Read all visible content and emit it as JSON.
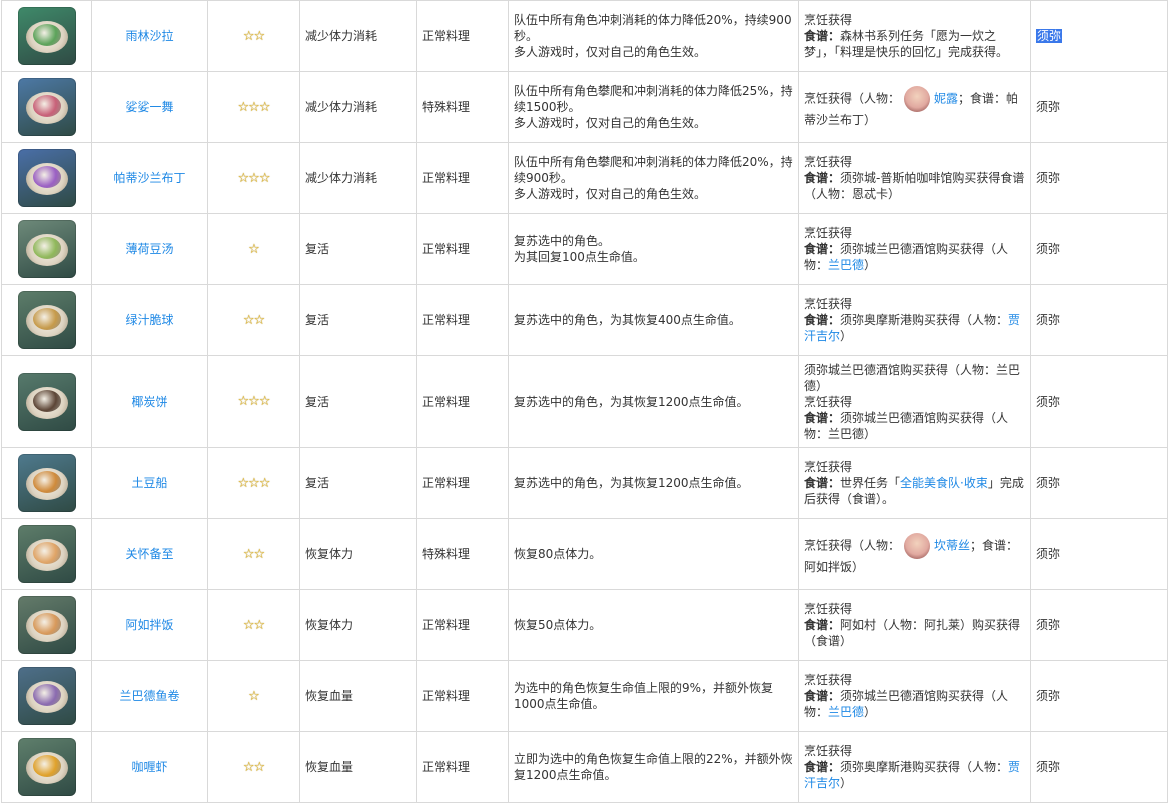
{
  "colors": {
    "link": "#1e88e5",
    "star": "#e8b923",
    "highlight": "#3a78ea",
    "border": "#d9d9d9"
  },
  "rows": [
    {
      "name": "雨林沙拉",
      "stars": "☆☆",
      "effect": "减少体力消耗",
      "type": "正常料理",
      "desc": [
        "队伍中所有角色冲刺消耗的体力降低20%，持续900秒。",
        "多人游戏时，仅对自己的角色生效。"
      ],
      "src": [
        {
          "t": "烹饪获得"
        },
        {
          "b": "食谱：",
          "t": "森林书系列任务「愿为一炊之梦」，「料理是快乐的回忆」完成获得。"
        }
      ],
      "region": "须弥",
      "region_selected": true,
      "icon": "salad-icon",
      "bg": "#3f8a6a",
      "food": "#5ba35a"
    },
    {
      "name": "娑娑一舞",
      "stars": "☆☆☆",
      "effect": "减少体力消耗",
      "type": "特殊料理",
      "desc": [
        "队伍中所有角色攀爬和冲刺消耗的体力降低25%，持续1500秒。",
        "多人游戏时，仅对自己的角色生效。"
      ],
      "src_avatar": {
        "pre": "烹饪获得（人物：",
        "char": "妮露",
        "post": "；食谱：帕蒂沙兰布丁）"
      },
      "region": "须弥",
      "icon": "pudding-icon",
      "bg": "#4d79a6",
      "food": "#c86078"
    },
    {
      "name": "帕蒂沙兰布丁",
      "stars": "☆☆☆",
      "effect": "减少体力消耗",
      "type": "正常料理",
      "desc": [
        "队伍中所有角色攀爬和冲刺消耗的体力降低20%，持续900秒。",
        "多人游戏时，仅对自己的角色生效。"
      ],
      "src": [
        {
          "t": "烹饪获得"
        },
        {
          "b": "食谱：",
          "t": "须弥城-普斯帕咖啡馆购买获得食谱（人物：恩忒卡）"
        }
      ],
      "region": "须弥",
      "icon": "purple-pudding-icon",
      "bg": "#4a6fa8",
      "food": "#9a5fc4"
    },
    {
      "name": "薄荷豆汤",
      "stars": "☆",
      "effect": "复活",
      "type": "正常料理",
      "desc": [
        "复苏选中的角色。",
        "为其回复100点生命值。"
      ],
      "src": [
        {
          "t": "烹饪获得"
        },
        {
          "b": "食谱：",
          "t": "须弥城兰巴德酒馆购买获得（人物：",
          "link": "兰巴德",
          "t2": "）"
        }
      ],
      "region": "须弥",
      "icon": "soup-icon",
      "bg": "#6e8a7a",
      "food": "#8fb85a"
    },
    {
      "name": "绿汁脆球",
      "stars": "☆☆",
      "effect": "复活",
      "type": "正常料理",
      "desc": [
        "复苏选中的角色，为其恢复400点生命值。"
      ],
      "src": [
        {
          "t": "烹饪获得"
        },
        {
          "b": "食谱：",
          "t": "须弥奥摩斯港购买获得（人物：",
          "link": "贾汗吉尔",
          "t2": "）"
        }
      ],
      "region": "须弥",
      "icon": "fried-balls-icon",
      "bg": "#5d7d6a",
      "food": "#c69a4a"
    },
    {
      "name": "椰炭饼",
      "stars": "☆☆☆",
      "effect": "复活",
      "type": "正常料理",
      "tall": true,
      "desc": [
        "复苏选中的角色，为其恢复1200点生命值。"
      ],
      "src": [
        {
          "t": "须弥城兰巴德酒馆购买获得（人物：兰巴德）"
        },
        {
          "t": "烹饪获得"
        },
        {
          "b": "食谱：",
          "t": "须弥城兰巴德酒馆购买获得（人物：兰巴德）"
        }
      ],
      "region": "须弥",
      "icon": "charcoal-cake-icon",
      "bg": "#577a6c",
      "food": "#5c4536"
    },
    {
      "name": "土豆船",
      "stars": "☆☆☆",
      "effect": "复活",
      "type": "正常料理",
      "desc": [
        "复苏选中的角色，为其恢复1200点生命值。"
      ],
      "src": [
        {
          "t": "烹饪获得"
        },
        {
          "b": "食谱：",
          "t": "世界任务「",
          "link": "全能美食队·收束",
          "t2": "」完成后获得（食谱）。"
        }
      ],
      "region": "须弥",
      "icon": "potato-boat-icon",
      "bg": "#4f7a8e",
      "food": "#d08a3a"
    },
    {
      "name": "关怀备至",
      "stars": "☆☆",
      "effect": "恢复体力",
      "type": "特殊料理",
      "desc": [
        "恢复80点体力。"
      ],
      "src_avatar": {
        "pre": "烹饪获得（人物：",
        "char": "坎蒂丝",
        "post": "；食谱：阿如拌饭）"
      },
      "region": "须弥",
      "icon": "rice-plate-icon",
      "bg": "#5e7d6a",
      "food": "#e0a466"
    },
    {
      "name": "阿如拌饭",
      "stars": "☆☆",
      "effect": "恢复体力",
      "type": "正常料理",
      "desc": [
        "恢复50点体力。"
      ],
      "src": [
        {
          "t": "烹饪获得"
        },
        {
          "b": "食谱：",
          "t": "阿如村（人物：阿扎莱）购买获得（食谱）"
        }
      ],
      "region": "须弥",
      "icon": "rice-bowl-icon",
      "bg": "#647b6a",
      "food": "#d8995a"
    },
    {
      "name": "兰巴德鱼卷",
      "stars": "☆",
      "effect": "恢复血量",
      "type": "正常料理",
      "desc": [
        "为选中的角色恢复生命值上限的9%，并额外恢复1000点生命值。"
      ],
      "src": [
        {
          "t": "烹饪获得"
        },
        {
          "b": "食谱：",
          "t": "须弥城兰巴德酒馆购买获得（人物：",
          "link": "兰巴德",
          "t2": "）"
        }
      ],
      "region": "须弥",
      "icon": "fish-roll-icon",
      "bg": "#4e6f8a",
      "food": "#8a6ab0"
    },
    {
      "name": "咖喱虾",
      "stars": "☆☆",
      "effect": "恢复血量",
      "type": "正常料理",
      "desc": [
        "立即为选中的角色恢复生命值上限的22%，并额外恢复1200点生命值。"
      ],
      "src": [
        {
          "t": "烹饪获得"
        },
        {
          "b": "食谱：",
          "t": "须弥奥摩斯港购买获得（人物：",
          "link": "贾汗吉尔",
          "t2": "）"
        }
      ],
      "region": "须弥",
      "icon": "curry-shrimp-icon",
      "bg": "#5f7f6c",
      "food": "#e0a12a"
    }
  ]
}
